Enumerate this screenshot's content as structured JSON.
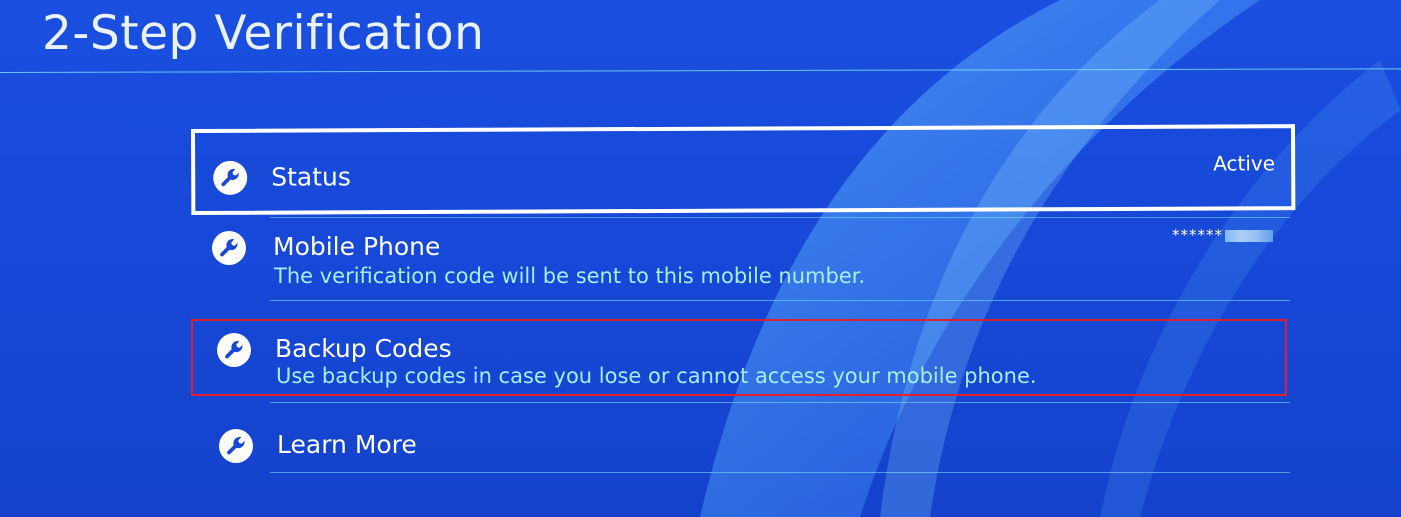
{
  "page": {
    "title": "2-Step Verification"
  },
  "menu": {
    "items": [
      {
        "id": "status",
        "icon": "wrench-icon",
        "label": "Status",
        "value": "Active",
        "selected": true
      },
      {
        "id": "mobile-phone",
        "icon": "wrench-icon",
        "label": "Mobile Phone",
        "description": "The verification code will be sent to this mobile number.",
        "value": "******"
      },
      {
        "id": "backup-codes",
        "icon": "wrench-icon",
        "label": "Backup Codes",
        "description": "Use backup codes in case you lose or cannot access your mobile phone.",
        "highlighted": true
      },
      {
        "id": "learn-more",
        "icon": "wrench-icon",
        "label": "Learn More"
      }
    ]
  },
  "colors": {
    "background": "#1748d8",
    "description_text": "#a6eeff",
    "selection_border": "#ffffff",
    "highlight_annotation": "#e0202c"
  }
}
